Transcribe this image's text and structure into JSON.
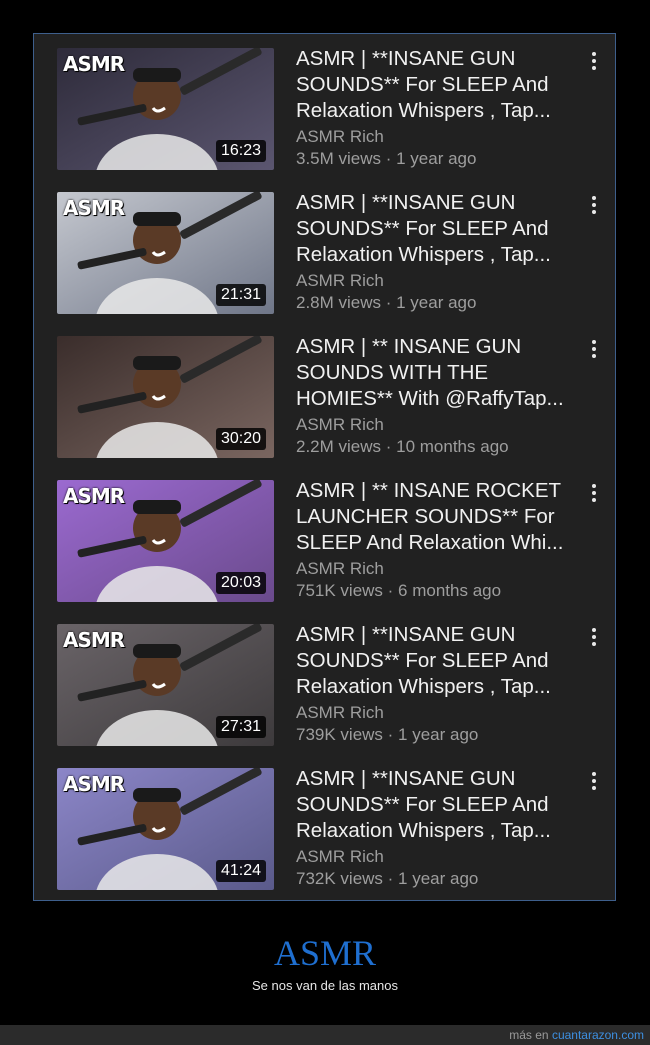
{
  "videos": [
    {
      "title": "ASMR | **INSANE GUN SOUNDS**  For SLEEP And Relaxation Whispers , Tap...",
      "channel": "ASMR Rich",
      "meta": "3.5M views · 1 year ago",
      "duration": "16:23",
      "tag": "ASMR",
      "bg": "#5b5670",
      "accent": "#2e2b3a"
    },
    {
      "title": "ASMR | **INSANE GUN SOUNDS**  For SLEEP And Relaxation Whispers , Tap...",
      "channel": "ASMR Rich",
      "meta": "2.8M views · 1 year ago",
      "duration": "21:31",
      "tag": "ASMR",
      "bg": "#6f7688",
      "accent": "#c5c8cf"
    },
    {
      "title": "ASMR | ** INSANE GUN SOUNDS WITH THE HOMIES** With @RaffyTap...",
      "channel": "ASMR Rich",
      "meta": "2.2M views · 10 months ago",
      "duration": "30:20",
      "tag": "",
      "bg": "#7a6660",
      "accent": "#3a2d2b"
    },
    {
      "title": "ASMR | ** INSANE ROCKET LAUNCHER SOUNDS** For SLEEP And Relaxation Whi...",
      "channel": "ASMR Rich",
      "meta": "751K views · 6 months ago",
      "duration": "20:03",
      "tag": "ASMR",
      "bg": "#6a4a8c",
      "accent": "#9b6ad0"
    },
    {
      "title": "ASMR | **INSANE GUN SOUNDS**  For SLEEP And Relaxation Whispers , Tap...",
      "channel": "ASMR Rich",
      "meta": "739K views · 1 year ago",
      "duration": "27:31",
      "tag": "ASMR",
      "bg": "#3d3a3c",
      "accent": "#6a6468"
    },
    {
      "title": "ASMR | **INSANE GUN SOUNDS**  For SLEEP And Relaxation Whispers , Tap...",
      "channel": "ASMR Rich",
      "meta": "732K views · 1 year ago",
      "duration": "41:24",
      "tag": "ASMR",
      "bg": "#5a5a8a",
      "accent": "#8c86c8"
    }
  ],
  "caption": {
    "title": "ASMR",
    "subtitle": "Se nos van de las manos"
  },
  "footer": {
    "prefix": "más en",
    "link": "cuantarazon.com"
  }
}
